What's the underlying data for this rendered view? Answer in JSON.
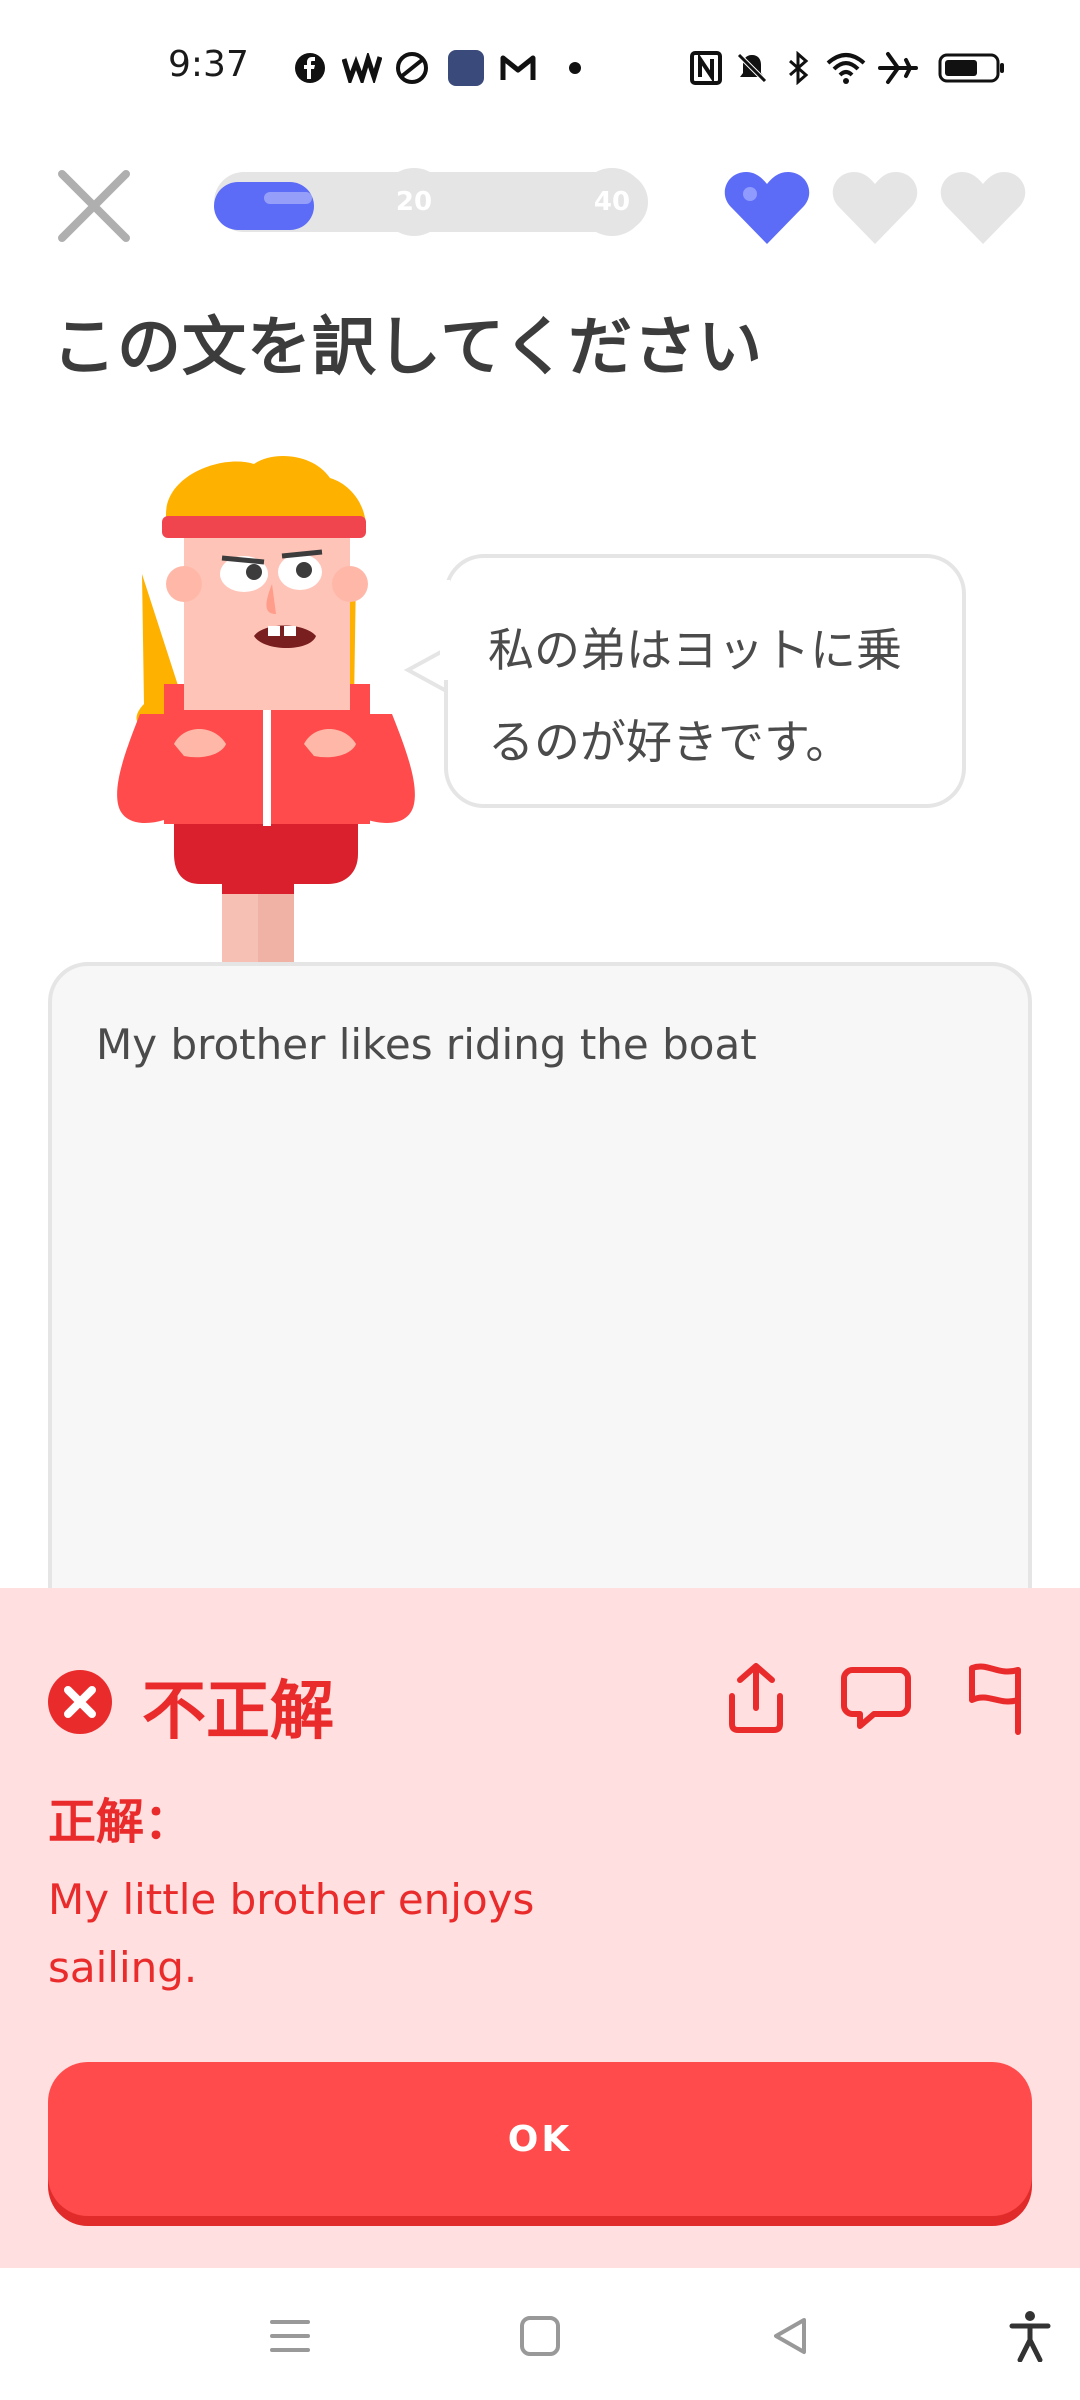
{
  "status_bar": {
    "time": "9:37",
    "icons": [
      "facebook-icon",
      "wwe-icon",
      "spotify-like-icon",
      "game-app-icon",
      "gmail-icon",
      "dot-icon",
      "nfc-icon",
      "mute-icon",
      "bluetooth-icon",
      "wifi-icon",
      "airplane-icon",
      "battery-icon"
    ]
  },
  "header": {
    "progress_fraction": 0.2,
    "milestones": [
      "20",
      "40"
    ],
    "hearts_total": 3,
    "hearts_filled": 1,
    "colors": {
      "accent": "#5c6cf7",
      "track": "#e5e5e5"
    }
  },
  "prompt": {
    "title": "この文を訳してください",
    "sentence_line1": "私の弟はヨットに乗",
    "sentence_line2": "るのが好きです。"
  },
  "answer": {
    "text": "My brother likes riding the boat"
  },
  "feedback": {
    "status": "不正解",
    "correct_label": "正解：",
    "correct_answer_line1": "My little brother enjoys",
    "correct_answer_line2": "sailing.",
    "colors": {
      "panel": "#ffdfe0",
      "text": "#ea2b2b",
      "button": "#ff4b4b"
    }
  },
  "ok_button": {
    "label": "OK"
  },
  "navbar": {
    "icons": [
      "menu-icon",
      "home-square-icon",
      "back-triangle-icon",
      "accessibility-icon"
    ]
  }
}
